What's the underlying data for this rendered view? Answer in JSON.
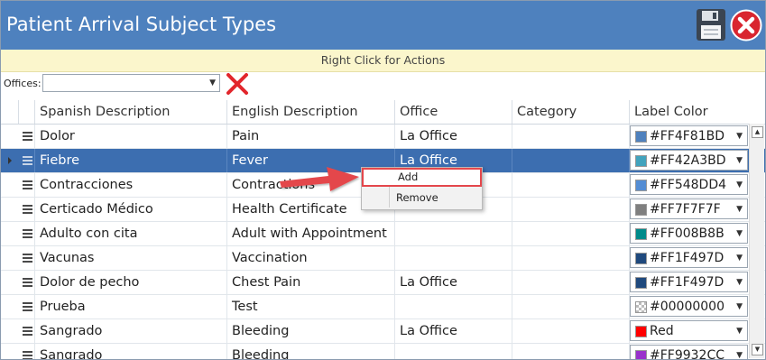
{
  "window": {
    "title": "Patient Arrival Subject Types",
    "title_bar_color": "#4e81be",
    "save_icon": "floppy-disk-icon",
    "close_icon": "red-close-circle-icon"
  },
  "hint": {
    "text": "Right Click for Actions",
    "background": "#fbf6cc"
  },
  "filter": {
    "label": "Offices:",
    "value": "",
    "clear_icon": "red-x-icon"
  },
  "grid": {
    "columns": [
      "Spanish Description",
      "English Description",
      "Office",
      "Category",
      "Label Color"
    ],
    "selected_row_index": 1,
    "rows": [
      {
        "spanish": "Dolor",
        "english": "Pain",
        "office": "La Office",
        "category": "",
        "color_label": "#FF4F81BD",
        "swatch": "#4f81bd"
      },
      {
        "spanish": "Fiebre",
        "english": "Fever",
        "office": "La Office",
        "category": "",
        "color_label": "#FF42A3BD",
        "swatch": "#42a3bd"
      },
      {
        "spanish": "Contracciones",
        "english": "Contractions",
        "office": "",
        "category": "",
        "color_label": "#FF548DD4",
        "swatch": "#548dd4"
      },
      {
        "spanish": "Certicado Médico",
        "english": "Health Certificate",
        "office": "",
        "category": "",
        "color_label": "#FF7F7F7F",
        "swatch": "#7f7f7f"
      },
      {
        "spanish": "Adulto con cita",
        "english": "Adult with Appointment",
        "office": "",
        "category": "",
        "color_label": "#FF008B8B",
        "swatch": "#008b8b"
      },
      {
        "spanish": "Vacunas",
        "english": "Vaccination",
        "office": "",
        "category": "",
        "color_label": "#FF1F497D",
        "swatch": "#1f497d"
      },
      {
        "spanish": "Dolor de pecho",
        "english": "Chest Pain",
        "office": "La Office",
        "category": "",
        "color_label": "#FF1F497D",
        "swatch": "#1f497d"
      },
      {
        "spanish": "Prueba",
        "english": "Test",
        "office": "",
        "category": "",
        "color_label": "#00000000",
        "swatch": "transparent"
      },
      {
        "spanish": "Sangrado",
        "english": "Bleeding",
        "office": "La Office",
        "category": "",
        "color_label": "Red",
        "swatch": "#ff0000"
      },
      {
        "spanish": "Sangrado",
        "english": "Bleeding",
        "office": "",
        "category": "",
        "color_label": "#FF9932CC",
        "swatch": "#9932cc"
      }
    ]
  },
  "context_menu": {
    "items": [
      {
        "label": "Add",
        "highlighted": true
      },
      {
        "label": "Remove",
        "highlighted": false
      }
    ]
  },
  "annotation": {
    "arrow_color": "#e4474c"
  },
  "scrollbar": {
    "up_icon": "chevron-up-icon",
    "down_icon": "chevron-down-icon"
  }
}
